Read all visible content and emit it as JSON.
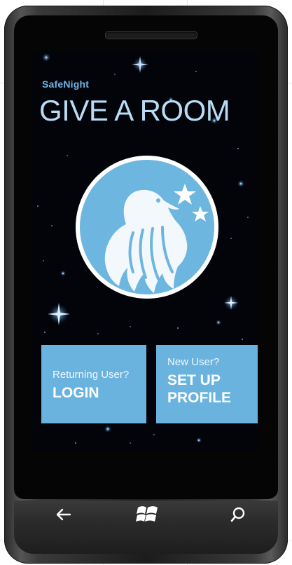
{
  "app": {
    "name": "SafeNight",
    "title": "GIVE A ROOM"
  },
  "logo": {
    "icon": "dove-with-stars-icon"
  },
  "tiles": {
    "login": {
      "subtitle": "Returning User?",
      "label": "LOGIN"
    },
    "setup": {
      "subtitle": "New User?",
      "label": "SET UP\nPROFILE"
    }
  },
  "hardware_buttons": [
    {
      "name": "back",
      "icon": "back-arrow-icon"
    },
    {
      "name": "start",
      "icon": "windows-logo-icon"
    },
    {
      "name": "search",
      "icon": "search-icon"
    }
  ],
  "colors": {
    "accent": "#6ab3df",
    "title": "#b9dcf4",
    "background": "#02040a"
  }
}
